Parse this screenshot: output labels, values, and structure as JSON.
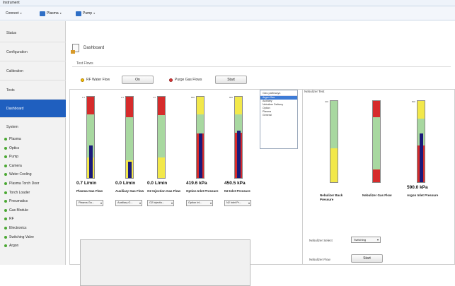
{
  "window": {
    "title": "Instrument"
  },
  "menu": [
    {
      "label": "Connect"
    },
    {
      "label": "Plasma"
    },
    {
      "label": "Pump"
    }
  ],
  "sidebar": {
    "items": [
      {
        "label": "Status"
      },
      {
        "label": "Configuration"
      },
      {
        "label": "Calibration"
      },
      {
        "label": "Tests"
      },
      {
        "label": "Dashboard"
      }
    ],
    "system_title": "System",
    "system_items": [
      {
        "label": "Plasma"
      },
      {
        "label": "Optics"
      },
      {
        "label": "Pump"
      },
      {
        "label": "Camera"
      },
      {
        "label": "Water Cooling"
      },
      {
        "label": "Plasma Torch Door"
      },
      {
        "label": "Torch Loader"
      },
      {
        "label": "Pneumatics"
      },
      {
        "label": "Gas Module"
      },
      {
        "label": "RF"
      },
      {
        "label": "Electronics"
      },
      {
        "label": "Switching Valve"
      },
      {
        "label": "Argon"
      }
    ]
  },
  "page": {
    "title": "Dashboard",
    "tests_label": "Test Flows",
    "rf_radio_label": "RF Water Flow",
    "rf_button": "On",
    "purge_radio_label": "Purge Gas Flows",
    "purge_button": "Start"
  },
  "gauges": [
    {
      "value": "0.7 L/min",
      "label": "Plasma Gas Flow",
      "select": "Plasma Ga...",
      "scale": [
        "1.5",
        "",
        "",
        "",
        "",
        ""
      ],
      "fill": 0.4
    },
    {
      "value": "0.0 L/min",
      "label": "Auxiliary Gas Flow",
      "select": "Auxiliary G...",
      "scale": [
        "1.5",
        "",
        "",
        "",
        "",
        ""
      ],
      "fill": 0.2
    },
    {
      "value": "0.0 L/min",
      "label": "O2 Injection Gas Flow",
      "select": "O2 Injectio...",
      "scale": [
        "1.0",
        "",
        "",
        "",
        "",
        ""
      ],
      "fill": 0.0
    },
    {
      "value": "419.6 kPa",
      "label": "Option Inlet Pressure",
      "select": "Option Inl...",
      "scale": [
        "800",
        "",
        "",
        "",
        "",
        ""
      ],
      "fill": 0.55
    },
    {
      "value": "450.5 kPa",
      "label": "N2 Inlet Pressure",
      "select": "N2 Inlet Pr...",
      "scale": [
        "800",
        "",
        "",
        "",
        "",
        ""
      ],
      "fill": 0.58
    }
  ],
  "listbox": {
    "header": "Gas pathways",
    "items": [
      "Argon Gas",
      "Auxiliary",
      "Nebulizer Delivery",
      "Option",
      "Plasma",
      "General"
    ],
    "selected_index": 0
  },
  "nebulizer": {
    "title": "Nebulizer Test",
    "gauges": [
      {
        "value": "",
        "label": "Nebulizer Back Pressure",
        "scale": [
          "400",
          "",
          "",
          "",
          "",
          ""
        ],
        "fill": 0.0
      },
      {
        "value": "",
        "label": "Nebulizer Gas Flow",
        "scale": [
          "",
          "",
          "",
          "",
          "",
          ""
        ],
        "fill": 0.0
      },
      {
        "value": "590.0 kPa",
        "label": "Argon Inlet Pressure",
        "scale": [
          "800",
          "",
          "",
          "",
          "",
          ""
        ],
        "fill": 0.6
      }
    ],
    "select_label": "Nebulizer Select",
    "select_value": "Switching",
    "flow_label": "Nebulizer Flow",
    "flow_button": "Start"
  },
  "colors": {
    "accent": "#1f5fbf",
    "red": "#d62b2b",
    "green": "#a8d8a0",
    "yellow": "#f2e84a",
    "fill": "#1a1a7a"
  }
}
